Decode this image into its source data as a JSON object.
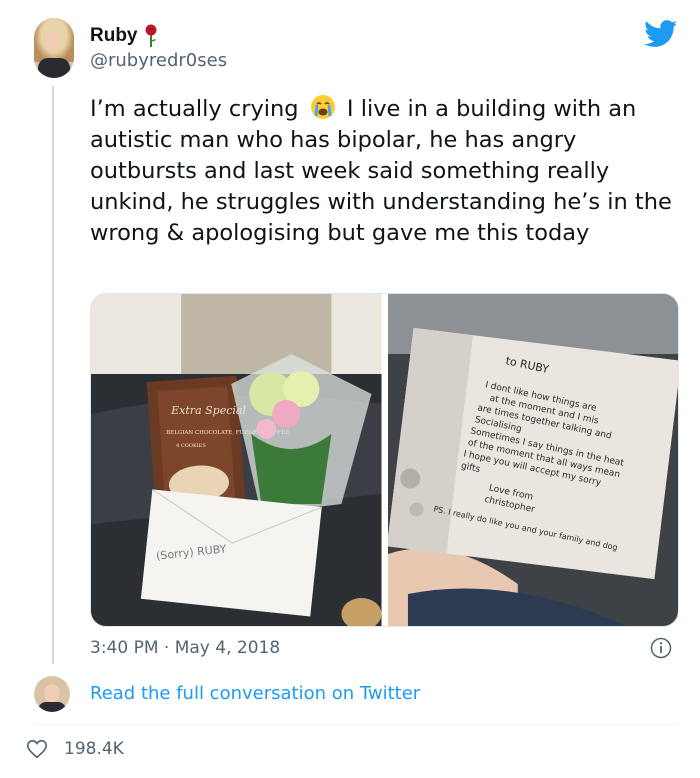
{
  "user": {
    "name": "Ruby",
    "handle": "@rubyredr0ses"
  },
  "tweet": {
    "text_before_emoji": "I’m actually crying ",
    "emoji": "crying-face-emoji",
    "text_after_emoji": " I live in a building with an autistic man who has bipolar, he has angry outbursts and last week said something really unkind, he struggles with understanding he’s in the wrong & apologising but gave me this today"
  },
  "media": {
    "photo1": {
      "description_icons": [
        "cookie-box",
        "flower-bouquet",
        "envelope"
      ],
      "box_brand": "Extra Special",
      "box_text": "BELGIAN CHOCOLATE, FUDGE & TOFFEE",
      "box_sub": "4 COOKIES",
      "envelope_text": "(Sorry) RUBY"
    },
    "photo2": {
      "card_lines": [
        "to RUBY",
        "I dont like how things are",
        "at the moment and I mis",
        "are times together talking and",
        "Socialising",
        "Sometimes I say things in the heat",
        "of the moment that all ways mean",
        "I hope you will accept my sorry",
        "gifts",
        "Love from",
        "christopher",
        "PS. I really do like you and your family and dog"
      ]
    }
  },
  "meta": {
    "timestamp": "3:40 PM · May 4, 2018",
    "conversation_link": "Read the full conversation on Twitter",
    "likes": "198.4K"
  },
  "colors": {
    "accent": "#1d9bf0",
    "secondary_text": "#536471",
    "heart_stroke": "#536471"
  }
}
